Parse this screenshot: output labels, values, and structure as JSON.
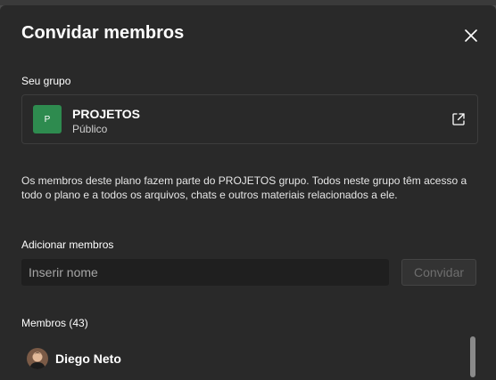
{
  "dialog": {
    "title": "Convidar membros"
  },
  "group_section": {
    "label": "Seu grupo",
    "avatar_letter": "P",
    "avatar_color": "#2e8b4f",
    "name": "PROJETOS",
    "privacy": "Público"
  },
  "description": "Os membros deste plano fazem parte do PROJETOS grupo. Todos neste grupo têm acesso a todo o plano e a todos os arquivos, chats e outros materiais relacionados a ele.",
  "add_members": {
    "label": "Adicionar membros",
    "input_placeholder": "Inserir nome",
    "input_value": "",
    "invite_button": "Convidar"
  },
  "members": {
    "heading": "Membros (43)",
    "items": [
      {
        "name": "Diego Neto"
      }
    ]
  },
  "icons": {
    "close": "close-icon",
    "open_external": "open-external-icon"
  }
}
